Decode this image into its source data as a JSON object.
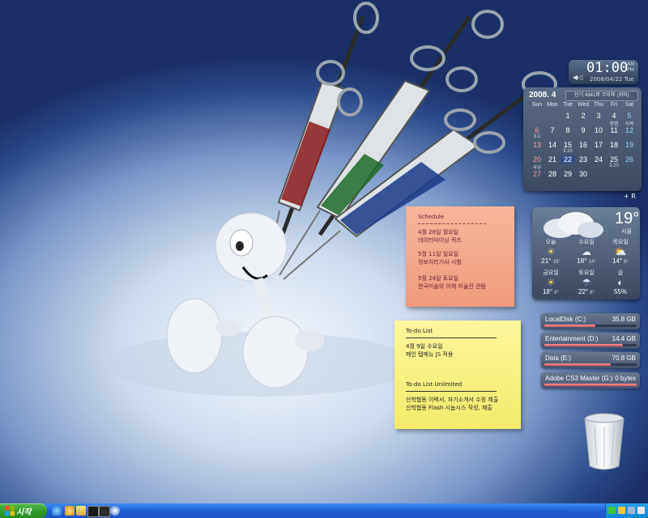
{
  "clock": {
    "time": "01:00",
    "am": "AM",
    "pm": "PM",
    "date": "2008/04/22 Tue"
  },
  "calendar": {
    "month": "2008. 4",
    "lunar": "단기 4341年 무자年 (쥐띠)",
    "weekdays": [
      "Sun",
      "Mon",
      "Tue",
      "Wed",
      "Thu",
      "Fri",
      "Sat"
    ],
    "days": [
      "",
      "",
      "1",
      "2",
      "3",
      "4",
      "5",
      "6",
      "7",
      "8",
      "9",
      "10",
      "11",
      "12",
      "13",
      "14",
      "15",
      "16",
      "17",
      "18",
      "19",
      "20",
      "21",
      "22",
      "23",
      "24",
      "25",
      "26",
      "27",
      "28",
      "29",
      "30",
      "",
      "",
      ""
    ],
    "notes": {
      "4": "청명",
      "5": "식목",
      "6": "3.1",
      "15": "3.10",
      "20": "곡우",
      "25": "3.20"
    },
    "nav": "+ R"
  },
  "weather": {
    "temp": "19°",
    "city": "서울",
    "forecast": [
      {
        "label": "오늘",
        "icon": "☀",
        "high": "21°",
        "low": "15°",
        "color": "#ffd24a"
      },
      {
        "label": "수요일",
        "icon": "☁",
        "high": "18°",
        "low": "14°",
        "color": "#e8eef6"
      },
      {
        "label": "목요일",
        "icon": "⛅",
        "high": "14°",
        "low": "8°",
        "color": "#ffd24a"
      },
      {
        "label": "금요일",
        "icon": "☀",
        "high": "18°",
        "low": "8°",
        "color": "#ffd24a"
      },
      {
        "label": "토요일",
        "icon": "☂",
        "high": "22°",
        "low": "8°",
        "color": "#cfe2ff"
      },
      {
        "label": "습",
        "icon": "◐",
        "high": "55%",
        "low": "",
        "color": "#e8eef6"
      }
    ]
  },
  "drives": [
    {
      "name": "LocalDisk (C:)",
      "size": "35.8 GB",
      "used": 0.55
    },
    {
      "name": "Entertainment (D:)",
      "size": "14.4 GB",
      "used": 0.85
    },
    {
      "name": "Data (E:)",
      "size": "70.8 GB",
      "used": 0.72
    },
    {
      "name": "Adobe CS3 Master (G:)",
      "size": "0 bytes",
      "used": 1.0
    }
  ],
  "schedule": {
    "title": "Schedule",
    "items": [
      {
        "date": "4월 28일 월요일",
        "text": "데이터마이닝 퀴즈"
      },
      {
        "date": "5월 11일 일요일",
        "text": "정보처리기사 시험"
      },
      {
        "date": "5월 24일 토요일",
        "text": "한국미술의 이해 미술관 관람"
      }
    ]
  },
  "todo": {
    "title": "To-do List",
    "date": "4월 9일 수요일",
    "item": "메인 탭메뉴 JS 적용",
    "title2": "To-do List Unlimited",
    "items2": [
      "산학협동 이력서, 자기소개서 수정 제출",
      "산학협동 Flash 시놉시스 작성, 제출"
    ]
  },
  "taskbar": {
    "start_label": "시작"
  },
  "colors": {
    "accent": "#2f4e86",
    "taskbar": "#1f5fd6",
    "start": "#2f9a2a",
    "note_pink": "#f4a98c",
    "note_yellow": "#f8f084"
  }
}
